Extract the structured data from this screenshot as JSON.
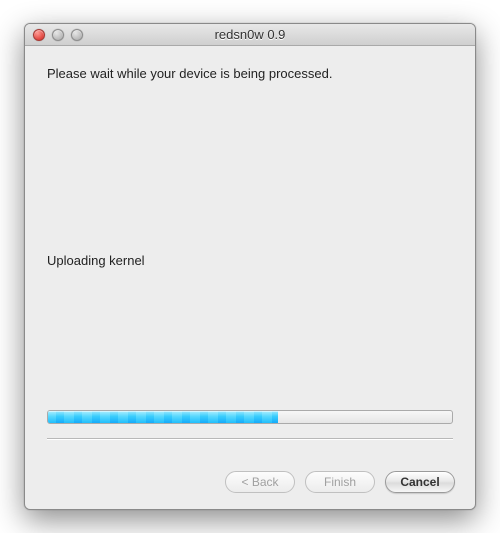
{
  "window": {
    "title": "redsn0w 0.9"
  },
  "content": {
    "instruction": "Please wait while your device is being processed.",
    "status": "Uploading kernel"
  },
  "progress": {
    "percent": 57
  },
  "buttons": {
    "back": "< Back",
    "finish": "Finish",
    "cancel": "Cancel"
  }
}
